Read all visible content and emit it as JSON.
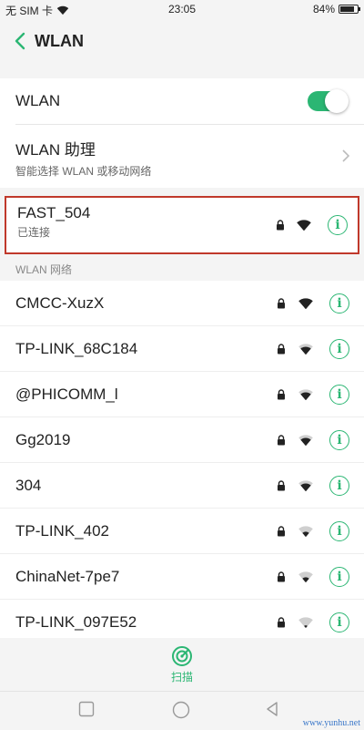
{
  "status_bar": {
    "carrier": "无 SIM 卡",
    "time": "23:05",
    "battery": "84%",
    "battery_level": 0.84
  },
  "header": {
    "title": "WLAN"
  },
  "wlan_toggle": {
    "label": "WLAN",
    "on": true
  },
  "assistant": {
    "label": "WLAN 助理",
    "sub": "智能选择 WLAN 或移动网络"
  },
  "connected": {
    "name": "FAST_504",
    "status": "已连接",
    "signal_bars": 4,
    "locked": true
  },
  "networks_header": "WLAN 网络",
  "networks": [
    {
      "name": "CMCC-XuzX",
      "signal_bars": 4,
      "locked": true
    },
    {
      "name": "TP-LINK_68C184",
      "signal_bars": 3,
      "locked": true
    },
    {
      "name": "@PHICOMM_l",
      "signal_bars": 3,
      "locked": true
    },
    {
      "name": "Gg2019",
      "signal_bars": 3,
      "locked": true
    },
    {
      "name": "304",
      "signal_bars": 3,
      "locked": true
    },
    {
      "name": "TP-LINK_402",
      "signal_bars": 2,
      "locked": true
    },
    {
      "name": "ChinaNet-7pe7",
      "signal_bars": 2,
      "locked": true
    },
    {
      "name": "TP-LINK_097E52",
      "signal_bars": 1,
      "locked": true
    }
  ],
  "scan": {
    "label": "扫描"
  },
  "watermark": "www.yunhu.net",
  "colors": {
    "accent": "#2bb673",
    "highlight_border": "#c0392b"
  }
}
